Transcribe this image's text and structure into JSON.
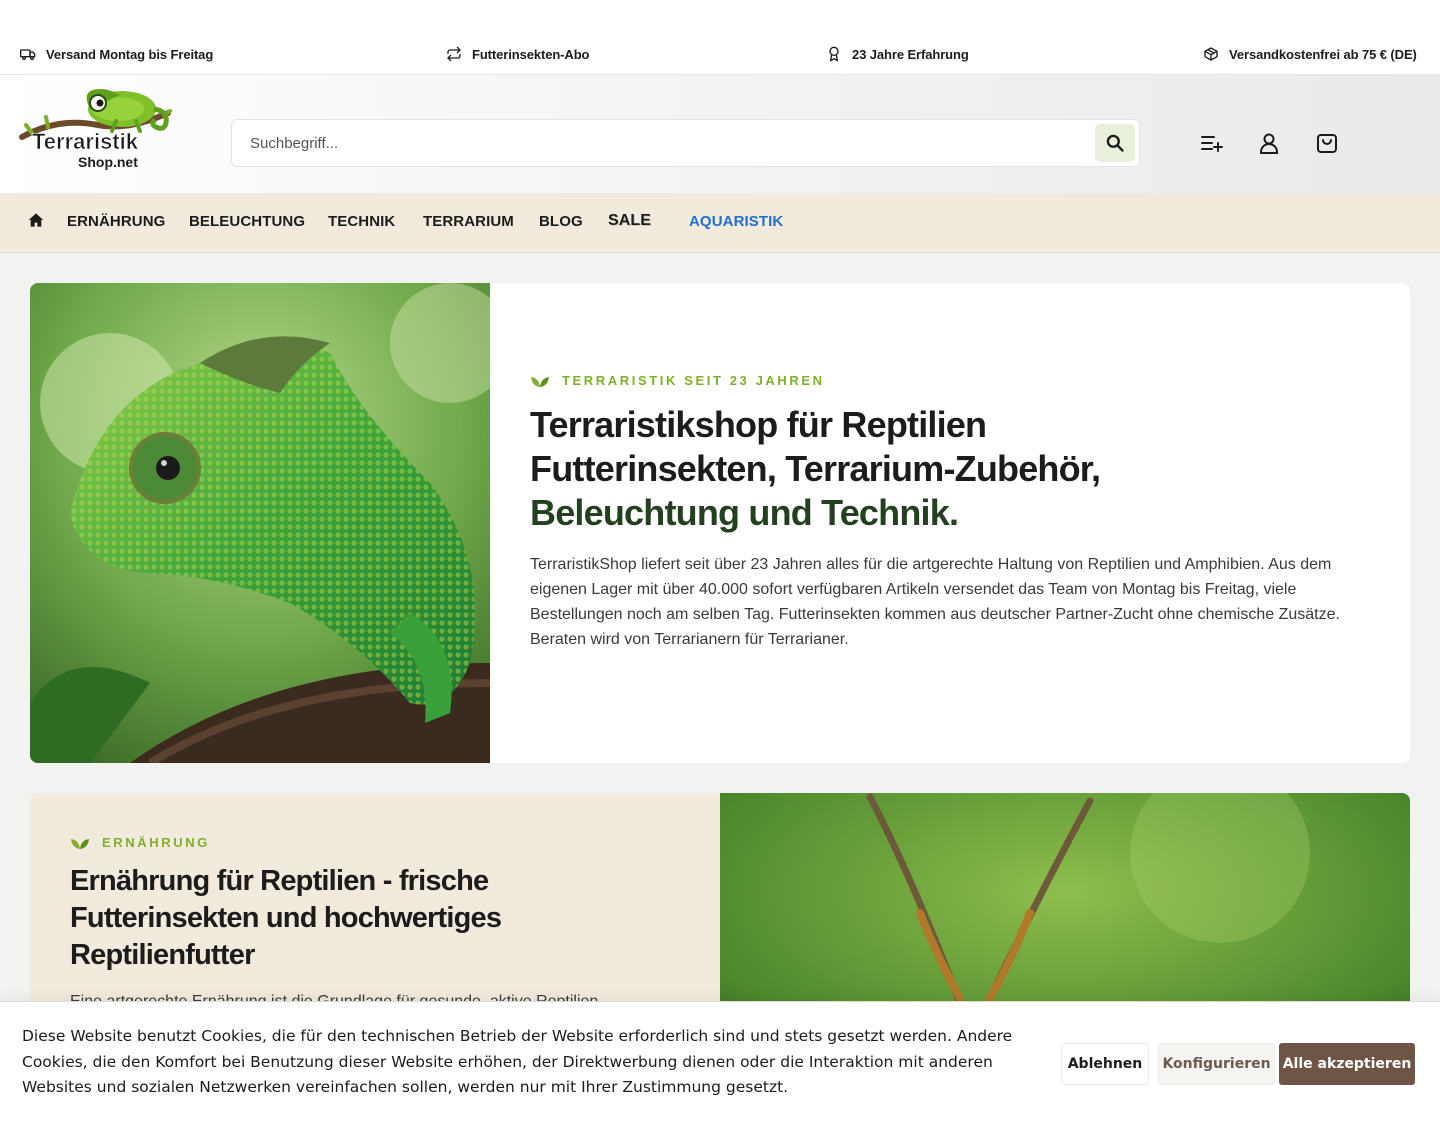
{
  "usp_bar": {
    "items": [
      {
        "icon": "truck-icon",
        "label": "Versand Montag bis Freitag"
      },
      {
        "icon": "repeat-icon",
        "label": "Futterinsekten-Abo"
      },
      {
        "icon": "award-icon",
        "label": "23 Jahre Erfahrung"
      },
      {
        "icon": "package-icon",
        "label": "Versandkostenfrei ab 75 € (DE)"
      }
    ]
  },
  "header": {
    "logo": {
      "line1": "Terraristik",
      "line2": "Shop.net"
    },
    "search": {
      "placeholder": "Suchbegriff..."
    },
    "icons": [
      "wishlist-icon",
      "account-icon",
      "cart-icon"
    ]
  },
  "nav": {
    "home_icon": "home-icon",
    "items": [
      {
        "label": "ERNÄHRUNG"
      },
      {
        "label": "BELEUCHTUNG"
      },
      {
        "label": "TECHNIK"
      },
      {
        "label": "TERRARIUM"
      },
      {
        "label": "BLOG"
      },
      {
        "label": "SALE"
      },
      {
        "label": "AQUARISTIK"
      }
    ],
    "colors": {
      "aquaristik": "#1f6fd0",
      "background": "#f2ebdd"
    }
  },
  "hero": {
    "eyebrow": "TERRARISTIK SEIT 23 JAHREN",
    "title_line1": "Terraristikshop für Reptilien",
    "title_line2": "Futterinsekten, Terrarium-Zubehör,",
    "title_accent": "Beleuchtung und Technik.",
    "text": "TerraristikShop liefert seit über 23 Jahren alles für die artgerechte Haltung von Reptilien und Amphibien. Aus dem eigenen Lager mit über 40.000 sofort verfügbaren Artikeln versendet das Team von Montag bis Freitag, viele Bestellungen noch am selben Tag. Futterinsekten kommen aus deutscher Partner-Zucht ohne chemische Zusätze. Beraten wird von Terrarianern für Terrarianer.",
    "colors": {
      "eyebrow": "#7fb02a",
      "accent": "#23401f"
    }
  },
  "section2": {
    "eyebrow": "ERNÄHRUNG",
    "title": "Ernährung für Reptilien - frische Futterinsekten und hochwertiges Reptilienfutter",
    "text": "Eine artgerechte Ernährung ist die Grundlage für gesunde, aktive Reptilien."
  },
  "cookie_banner": {
    "text": "Diese Website benutzt Cookies, die für den technischen Betrieb der Website erforderlich sind und stets gesetzt werden. Andere Cookies, die den Komfort bei Benutzung dieser Website erhöhen, der Direktwerbung dienen oder die Interaktion mit anderen Websites und sozialen Netzwerken vereinfachen sollen, werden nur mit Ihrer Zustimmung gesetzt.",
    "deny_label": "Ablehnen",
    "configure_label": "Konfigurieren",
    "accept_label": "Alle akzeptieren",
    "colors": {
      "accept": "#6f5546"
    }
  }
}
